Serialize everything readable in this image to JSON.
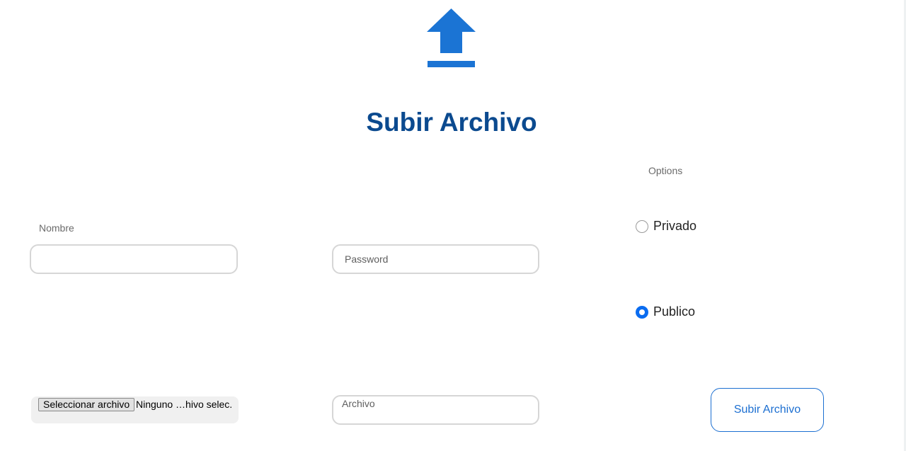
{
  "header": {
    "icon": "upload-icon",
    "title": "Subir Archivo"
  },
  "form": {
    "nombre_label": "Nombre",
    "nombre_value": "",
    "password_placeholder": "Password",
    "options_label": "Options",
    "options": [
      {
        "label": "Privado",
        "checked": false
      },
      {
        "label": "Publico",
        "checked": true
      }
    ],
    "file_button_label": "Seleccionar archivo",
    "file_status": "Ninguno …hivo selec.",
    "archivo_placeholder": "Archivo",
    "submit_label": "Subir Archivo"
  },
  "colors": {
    "accent": "#1c6fd1",
    "title": "#0b4a8f",
    "icon": "#1b74d4",
    "radio_checked": "#0a6cf0"
  }
}
